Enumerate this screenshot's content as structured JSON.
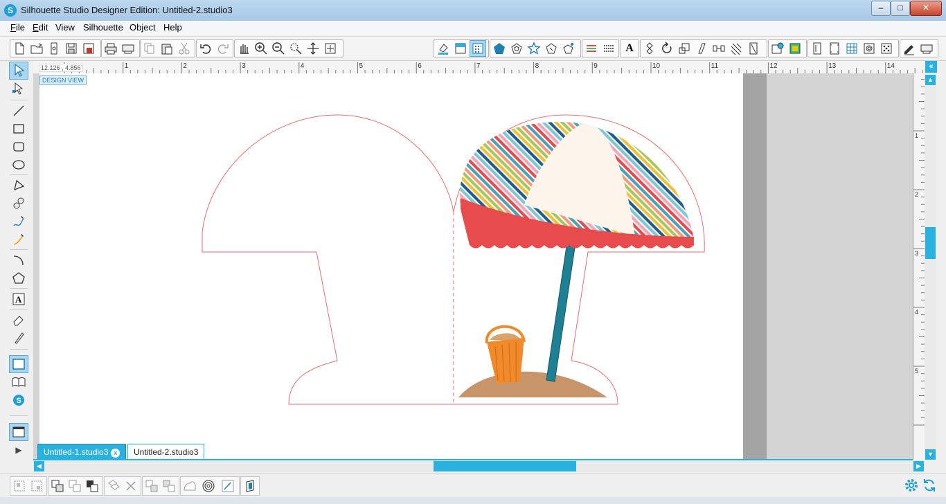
{
  "window": {
    "title": "Silhouette Studio Designer Edition: Untitled-2.studio3",
    "logo_letter": "S",
    "minimize": "–",
    "maximize": "□",
    "close": "✕"
  },
  "menu": {
    "items": [
      {
        "u": "F",
        "rest": "ile"
      },
      {
        "u": "E",
        "rest": "dit"
      },
      {
        "u": "",
        "rest": "View"
      },
      {
        "u": "",
        "rest": "Silhouette"
      },
      {
        "u": "",
        "rest": "Object"
      },
      {
        "u": "",
        "rest": "Help"
      }
    ]
  },
  "toolbar": {
    "text_tool_glyph": "A"
  },
  "ruler": {
    "coord_readout": "12.126 , 4.856",
    "h_labels": [
      "1",
      "2",
      "3",
      "4",
      "5",
      "6",
      "7",
      "8",
      "9",
      "10",
      "11",
      "12",
      "13",
      "14"
    ],
    "v_labels": [
      "1",
      "2",
      "3",
      "4",
      "5"
    ]
  },
  "canvas": {
    "design_view_label": "DESIGN VIEW",
    "colors": {
      "cut_line": "#ef6b6b",
      "pole": "#1f7f93",
      "sand": "#c8956a",
      "bucket": "#f08a2a",
      "scallop": "#e84b4b",
      "canopy_panel": "#fdf5ec"
    }
  },
  "tabs": {
    "items": [
      {
        "label": "Untitled-1.studio3",
        "close": "x"
      },
      {
        "label": "Untitled-2.studio3",
        "close": ""
      }
    ]
  },
  "scroll": {
    "up": "▲",
    "down": "▼",
    "left": "◀",
    "right": "▶",
    "collapse": "«"
  },
  "panel_toggles": {
    "arrow": "▶"
  },
  "theme": {
    "accent": "#29b2e0"
  }
}
